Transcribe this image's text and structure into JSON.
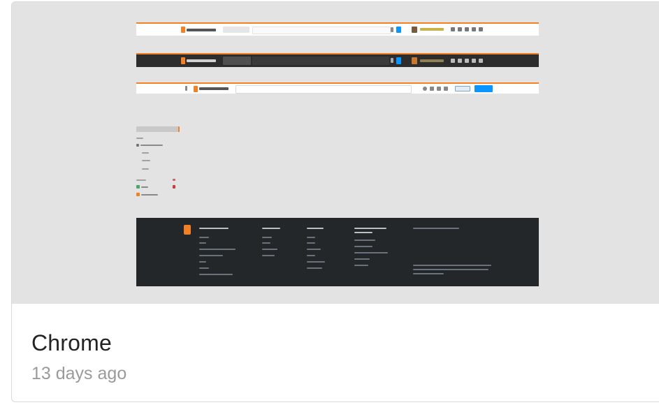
{
  "card": {
    "title": "Chrome",
    "timestamp": "13 days ago"
  },
  "thumbnail": {
    "icon": "screenshot-preview",
    "accent_color": "#f48024",
    "footer_color": "#242729",
    "dark_header_color": "#2d2d2d",
    "primary_button_color": "#0a95ff"
  }
}
